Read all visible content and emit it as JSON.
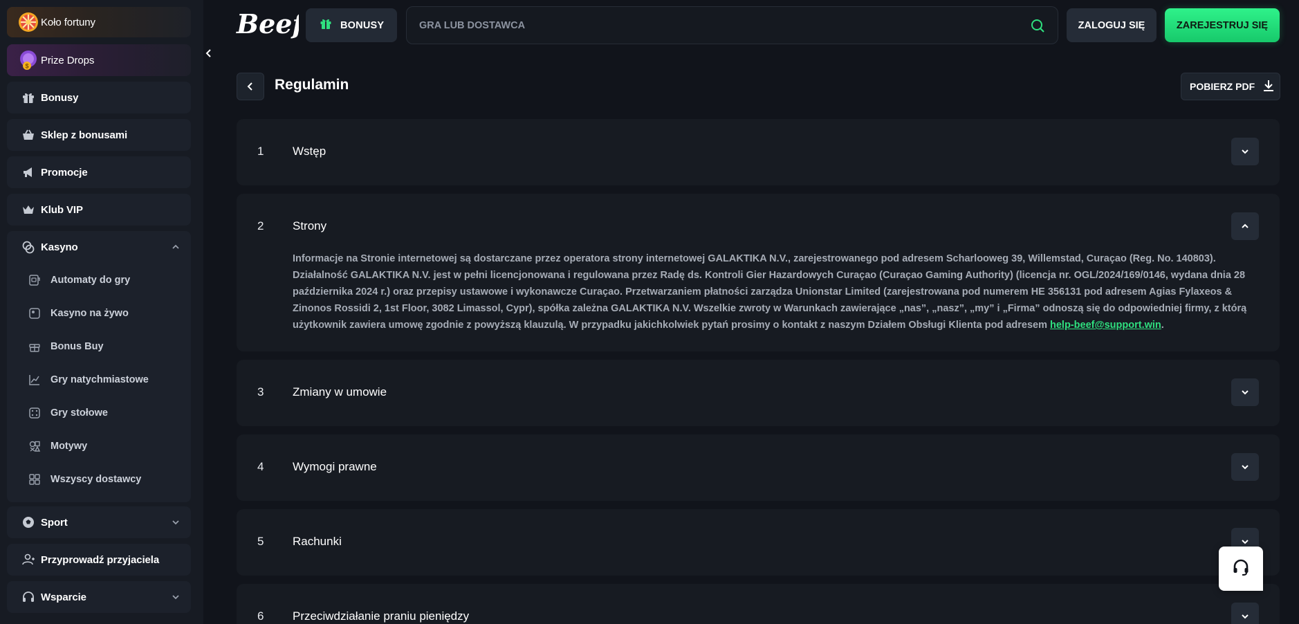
{
  "sidebar": {
    "wheel": {
      "label": "Koło fortuny",
      "icon": "wheel-of-fortune-icon"
    },
    "prize_drops": {
      "label": "Prize Drops",
      "icon": "prize-coin-icon"
    },
    "items": [
      {
        "label": "Bonusy",
        "icon": "gift-icon"
      },
      {
        "label": "Sklep z bonusami",
        "icon": "shop-basket-icon"
      },
      {
        "label": "Promocje",
        "icon": "megaphone-icon"
      },
      {
        "label": "Klub VIP",
        "icon": "crown-icon"
      }
    ],
    "casino": {
      "label": "Kasyno",
      "icon": "casino-chips-icon",
      "sub_items": [
        {
          "label": "Automaty do gry",
          "icon": "slot-machine-icon"
        },
        {
          "label": "Kasyno na żywo",
          "icon": "live-casino-icon"
        },
        {
          "label": "Bonus Buy",
          "icon": "bonus-buy-icon"
        },
        {
          "label": "Gry natychmiastowe",
          "icon": "instant-games-icon"
        },
        {
          "label": "Gry stołowe",
          "icon": "dice-icon"
        },
        {
          "label": "Motywy",
          "icon": "themes-icon"
        },
        {
          "label": "Wszyscy dostawcy",
          "icon": "providers-grid-icon"
        }
      ]
    },
    "sport": {
      "label": "Sport",
      "icon": "ball-icon"
    },
    "refer": {
      "label": "Przyprowadź przyjaciela",
      "icon": "add-friend-icon"
    },
    "support": {
      "label": "Wsparcie",
      "icon": "headset-icon"
    }
  },
  "header": {
    "logo_text": "Beef",
    "bonus_button": "BONUSY",
    "search_placeholder": "GRA LUB DOSTAWCA",
    "login_button": "ZALOGUJ SIĘ",
    "register_button": "ZAREJESTRUJ SIĘ"
  },
  "page": {
    "title": "Regulamin",
    "pdf_button": "POBIERZ PDF"
  },
  "sections": [
    {
      "num": "1",
      "title": "Wstęp",
      "expanded": false
    },
    {
      "num": "2",
      "title": "Strony",
      "expanded": true,
      "body": "Informacje na Stronie internetowej są dostarczane przez operatora strony internetowej GALAKTIKA N.V., zarejestrowanego pod adresem Scharlooweg 39, Willemstad, Curaçao (Reg. No. 140803). Działalność GALAKTIKA N.V. jest w pełni licencjonowana i regulowana przez Radę ds. Kontroli Gier Hazardowych Curaçao (Curaçao Gaming Authority) (licencja nr. OGL/2024/169/0146, wydana dnia 28 października 2024 r.) oraz przepisy ustawowe i wykonawcze Curaçao. Przetwarzaniem płatności zarządza Unionstar Limited (zarejestrowana pod numerem HE 356131 pod adresem Agias Fylaxeos & Zinonos Rossidi 2, 1st Floor, 3082 Limassol, Cypr), spółka zależna GALAKTIKA N.V. Wszelkie zwroty w Warunkach zawierające „nas”, „nasz”, „my” i „Firma” odnoszą się do odpowiedniej firmy, z którą użytkownik zawiera umowę zgodnie z powyższą klauzulą. W przypadku jakichkolwiek pytań prosimy o kontakt z naszym Działem Obsługi Klienta pod adresem ",
      "email": "help-beef@support.win",
      "body_end": "."
    },
    {
      "num": "3",
      "title": "Zmiany w umowie",
      "expanded": false
    },
    {
      "num": "4",
      "title": "Wymogi prawne",
      "expanded": false
    },
    {
      "num": "5",
      "title": "Rachunki",
      "expanded": false
    },
    {
      "num": "6",
      "title": "Przeciwdziałanie praniu pieniędzy",
      "expanded": false
    }
  ],
  "colors": {
    "accent_green": "#2fe07f",
    "background": "#11141b",
    "sidebar": "#171b23",
    "card": "#171b22"
  },
  "floating": {
    "icon": "support-headset-icon"
  }
}
